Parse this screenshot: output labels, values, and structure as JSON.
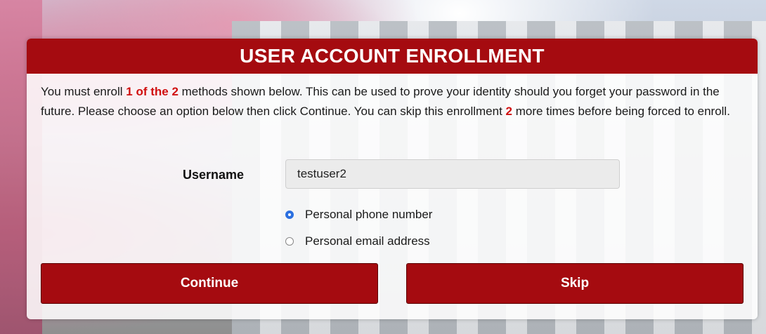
{
  "header": {
    "title": "USER ACCOUNT ENROLLMENT"
  },
  "instructions": {
    "part1": "You must enroll ",
    "highlight1": "1 of the 2",
    "part2": " methods shown below. This can be used to prove your identity should you forget your password in the future. Please choose an option below then click Continue. You can skip this enrollment ",
    "highlight2": "2",
    "part3": " more times before being forced to enroll."
  },
  "username": {
    "label": "Username",
    "value": "testuser2"
  },
  "options": [
    {
      "label": "Personal phone number",
      "checked": true
    },
    {
      "label": "Personal email address",
      "checked": false
    }
  ],
  "buttons": {
    "continue_label": "Continue",
    "skip_label": "Skip"
  },
  "colors": {
    "brand_red": "#a50b10",
    "highlight_red": "#d01010",
    "radio_blue": "#2b6fe0"
  }
}
